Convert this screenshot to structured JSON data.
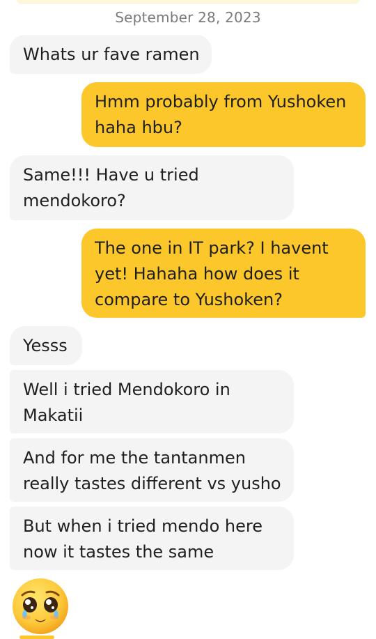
{
  "chat": {
    "date_separator": "September 28, 2023",
    "messages": [
      {
        "side": "incoming",
        "lines": [
          "Whats ur fave ramen"
        ]
      },
      {
        "side": "outgoing",
        "lines": [
          "Hmm probably from Yushoken",
          "haha hbu?"
        ]
      },
      {
        "side": "incoming",
        "lines": [
          "Same!!! Have u tried",
          "mendokoro?"
        ]
      },
      {
        "side": "outgoing",
        "lines": [
          "The one in IT park? I havent",
          "yet! Hahaha how does it",
          "compare to Yushoken?"
        ]
      },
      {
        "side": "incoming",
        "lines": [
          "Yesss"
        ]
      },
      {
        "side": "incoming",
        "lines": [
          "Well i tried Mendokoro in",
          "Makatii"
        ]
      },
      {
        "side": "incoming",
        "lines": [
          "And for me the tantanmen",
          "really tastes different vs yusho"
        ]
      },
      {
        "side": "incoming",
        "lines": [
          "But when i tried mendo here",
          "now it tastes the same"
        ]
      }
    ],
    "emoji_message": {
      "icon": "pleading-face-with-tears-emoji"
    }
  },
  "colors": {
    "incoming_bubble": "#f4f4f4",
    "outgoing_bubble": "#fcc72a",
    "text": "#1f1f1f",
    "date_text": "#7a7a7a"
  }
}
